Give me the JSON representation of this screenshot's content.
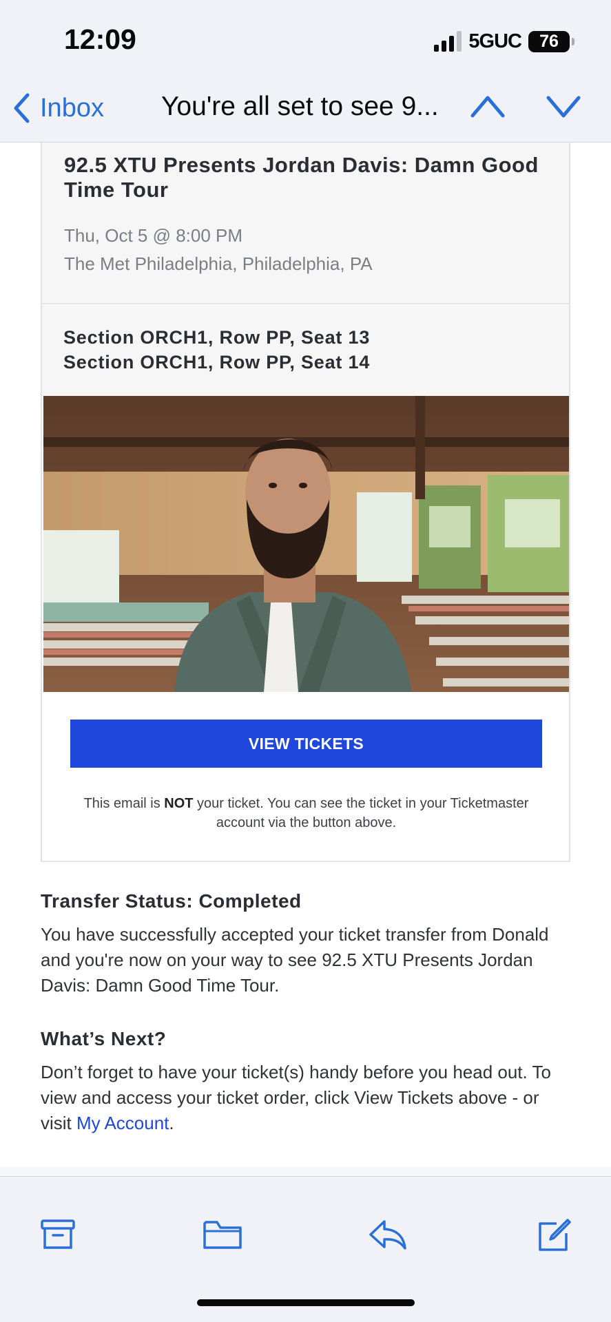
{
  "status_bar": {
    "time": "12:09",
    "network": "5GUC",
    "battery": "76"
  },
  "nav": {
    "back_label": "Inbox",
    "title": "You're all set to see 9...",
    "accent_color": "#2a6fd8"
  },
  "event": {
    "title": "92.5 XTU Presents Jordan Davis: Damn Good Time Tour",
    "date": "Thu, Oct 5 @ 8:00 PM",
    "venue": "The Met Philadelphia, Philadelphia, PA"
  },
  "seats": [
    "Section ORCH1, Row PP, Seat 13",
    "Section ORCH1, Row PP, Seat 14"
  ],
  "photo": {
    "icon": "artist-photo"
  },
  "cta": {
    "label": "VIEW TICKETS",
    "color": "#1f47db"
  },
  "disclaimer": {
    "prefix": "This email is ",
    "emphasis": "NOT",
    "suffix": " your ticket. You can see the ticket in your Ticketmaster account via the button above."
  },
  "transfer": {
    "heading": "Transfer Status: Completed",
    "body": "You have successfully accepted your ticket transfer from Donald and you're now on your way to see 92.5 XTU Presents Jordan Davis: Damn Good Time Tour."
  },
  "next": {
    "heading": "What’s Next?",
    "body_prefix": "Don’t forget to have your ticket(s) handy before you head out. To view and access your ticket order, click View Tickets above - or visit ",
    "link_label": "My Account",
    "body_suffix": "."
  },
  "toolbar": {
    "icons": [
      "archive-icon",
      "folder-icon",
      "reply-icon",
      "compose-icon"
    ]
  }
}
